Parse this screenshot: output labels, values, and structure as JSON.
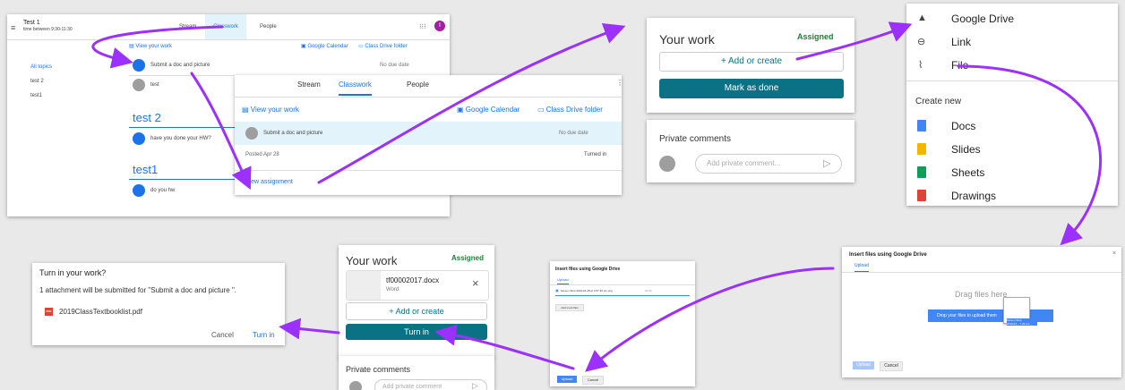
{
  "classroom_main": {
    "class_title": "Test 1",
    "class_sub": "time between 9:30-11:30",
    "tabs": [
      "Stream",
      "Classwork",
      "People"
    ],
    "avatar_letter": "I",
    "view_your_work": "View your work",
    "google_calendar": "Google Calendar",
    "class_drive_folder": "Class Drive folder",
    "topics": [
      "All topics",
      "test 2",
      "test1"
    ],
    "assignments": [
      {
        "title": "Submit a doc and picture",
        "due": "No due date"
      },
      {
        "title": "test",
        "due": ""
      }
    ],
    "section_test2": "test 2",
    "item_test2": "have you done your HW?",
    "section_test1": "test1",
    "item_test1": "do you hw"
  },
  "classroom_zoom": {
    "tabs": [
      "Stream",
      "Classwork",
      "People"
    ],
    "view_your_work": "View your work",
    "google_calendar": "Google Calendar",
    "class_drive_folder": "Class Drive folder",
    "assignment_title": "Submit a doc and picture",
    "due": "No due date",
    "posted": "Posted Apr 28",
    "status": "Turned in",
    "view_assignment": "View assignment"
  },
  "your_work_card": {
    "title": "Your work",
    "status": "Assigned",
    "add_or_create": "Add or create",
    "mark_as_done": "Mark as done",
    "private_comments": "Private comments",
    "comment_placeholder": "Add private comment..."
  },
  "add_menu": {
    "items": [
      "Google Drive",
      "Link",
      "File"
    ],
    "create_new": "Create new",
    "create_items": [
      "Docs",
      "Slides",
      "Sheets",
      "Drawings"
    ]
  },
  "drive_upload_big": {
    "title": "Insert files using Google Drive",
    "tab": "Upload",
    "drag_text": "Drag files here",
    "drop_text": "Drop your files to upload them",
    "file_chip": "Screen Shot\n2019-01-...7.28 pm",
    "upload_btn": "Upload",
    "cancel_btn": "Cancel"
  },
  "drive_upload_small": {
    "title": "Insert files using Google Drive",
    "tab": "Upload",
    "file_row": "Screen Shot 2019-01-28 at 4.57.36 pm.png",
    "file_size": "94.6K",
    "add_more": "Add more files",
    "upload_btn": "Upload",
    "cancel_btn": "Cancel"
  },
  "your_work_submitted": {
    "title": "Your work",
    "status": "Assigned",
    "file_name": "tf00002017.docx",
    "file_type": "Word",
    "add_or_create": "Add or create",
    "turn_in": "Turn in",
    "private_comments": "Private comments",
    "comment_placeholder": "Add private comment"
  },
  "turn_in_dialog": {
    "title": "Turn in your work?",
    "body": "1 attachment will be submitted for \"Submit a doc and picture \".",
    "file_badge": "PDF",
    "file_name": "2019ClassTextbooklist.pdf",
    "cancel": "Cancel",
    "turn_in": "Turn in"
  },
  "colors": {
    "arrow": "#9b30ff",
    "teal": "#0b7285",
    "blue": "#1a73e8",
    "green": "#188038"
  }
}
